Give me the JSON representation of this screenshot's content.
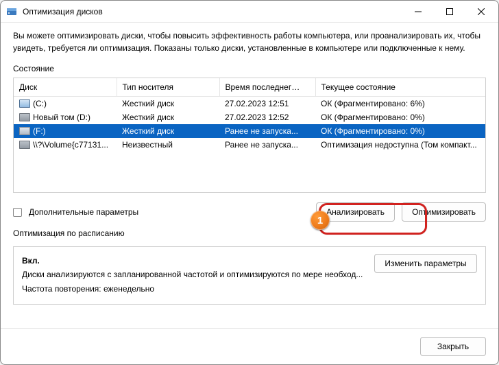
{
  "title": "Оптимизация дисков",
  "intro": "Вы можете оптимизировать диски, чтобы повысить эффективность работы  компьютера, или проанализировать их, чтобы увидеть, требуется ли оптимизация. Показаны только диски, установленные в компьютере или подключенные к нему.",
  "status_label": "Состояние",
  "columns": {
    "disk": "Диск",
    "type": "Тип носителя",
    "last": "Время последнег…",
    "state": "Текущее состояние"
  },
  "rows": [
    {
      "name": "(C:)",
      "type": "Жесткий диск",
      "last": "27.02.2023 12:51",
      "state": "ОК (Фрагментировано: 6%)",
      "icon": "os",
      "selected": false
    },
    {
      "name": "Новый том (D:)",
      "type": "Жесткий диск",
      "last": "27.02.2023 12:52",
      "state": "ОК (Фрагментировано: 0%)",
      "icon": "hdd",
      "selected": false
    },
    {
      "name": "(F:)",
      "type": "Жесткий диск",
      "last": "Ранее не запуска...",
      "state": "ОК (Фрагментировано: 0%)",
      "icon": "hdd",
      "selected": true
    },
    {
      "name": "\\\\?\\Volume{c77131...",
      "type": "Неизвестный",
      "last": "Ранее не запуска...",
      "state": "Оптимизация недоступна (Том компакт...",
      "icon": "hdd",
      "selected": false
    }
  ],
  "advanced_label": "Дополнительные параметры",
  "analyze_label": "Анализировать",
  "optimize_label": "Оптимизировать",
  "schedule": {
    "section_label": "Оптимизация по расписанию",
    "status": "Вкл.",
    "line1": "Диски анализируются с запланированной частотой и оптимизируются по мере необход...",
    "freq_label": "Частота повторения:",
    "freq_value": "еженедельно",
    "change_label": "Изменить параметры"
  },
  "close_label": "Закрыть",
  "callout_badge": "1"
}
